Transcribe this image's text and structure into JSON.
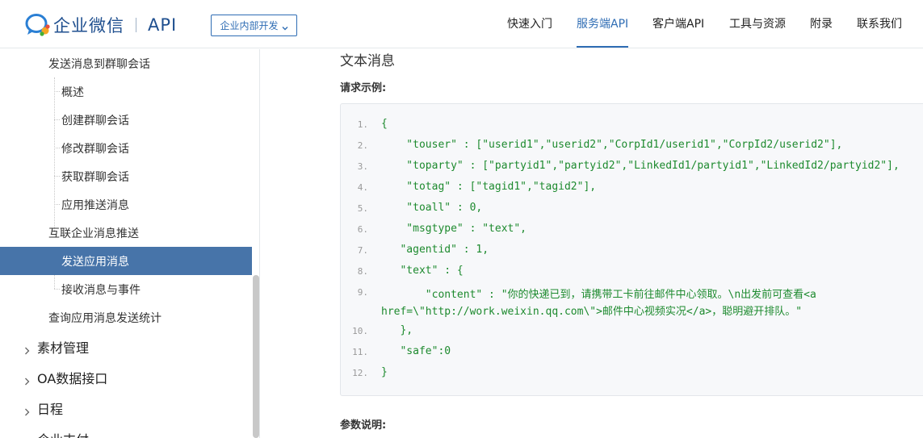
{
  "header": {
    "logo_text": "企业微信",
    "logo_api": "API",
    "dropdown_label": "企业内部开发",
    "nav": [
      "快速入门",
      "服务端API",
      "客户端API",
      "工具与资源",
      "附录",
      "联系我们"
    ],
    "active_nav": "服务端API"
  },
  "sidebar": {
    "items": [
      "发送消息到群聊会话",
      "概述",
      "创建群聊会话",
      "修改群聊会话",
      "获取群聊会话",
      "应用推送消息",
      "互联企业消息推送",
      "发送应用消息",
      "接收消息与事件",
      "查询应用消息发送统计",
      "素材管理",
      "OA数据接口",
      "日程",
      "企业支付"
    ],
    "active_item": "发送应用消息"
  },
  "main": {
    "section_title": "文本消息",
    "request_label": "请求示例:",
    "code_lines": [
      {
        "n": "1.",
        "text": "{"
      },
      {
        "n": "2.",
        "text": "    \"touser\" : [\"userid1\",\"userid2\",\"CorpId1/userid1\",\"CorpId2/userid2\"],"
      },
      {
        "n": "3.",
        "text": "    \"toparty\" : [\"partyid1\",\"partyid2\",\"LinkedId1/partyid1\",\"LinkedId2/partyid2\"],"
      },
      {
        "n": "4.",
        "text": "    \"totag\" : [\"tagid1\",\"tagid2\"],"
      },
      {
        "n": "5.",
        "text": "    \"toall\" : 0,"
      },
      {
        "n": "6.",
        "text": "    \"msgtype\" : \"text\","
      },
      {
        "n": "7.",
        "text": "   \"agentid\" : 1,"
      },
      {
        "n": "8.",
        "text": "   \"text\" : {"
      },
      {
        "n": "9.",
        "text": "       \"content\" : \"你的快递已到，请携带工卡前往邮件中心领取。\\n出发前可查看<a"
      },
      {
        "n": "",
        "text": "href=\\\"http://work.weixin.qq.com\\\">邮件中心视频实况</a>，聪明避开排队。\""
      },
      {
        "n": "10.",
        "text": "   },"
      },
      {
        "n": "11.",
        "text": "   \"safe\":0"
      },
      {
        "n": "12.",
        "text": "}"
      }
    ],
    "param_label": "参数说明:"
  }
}
